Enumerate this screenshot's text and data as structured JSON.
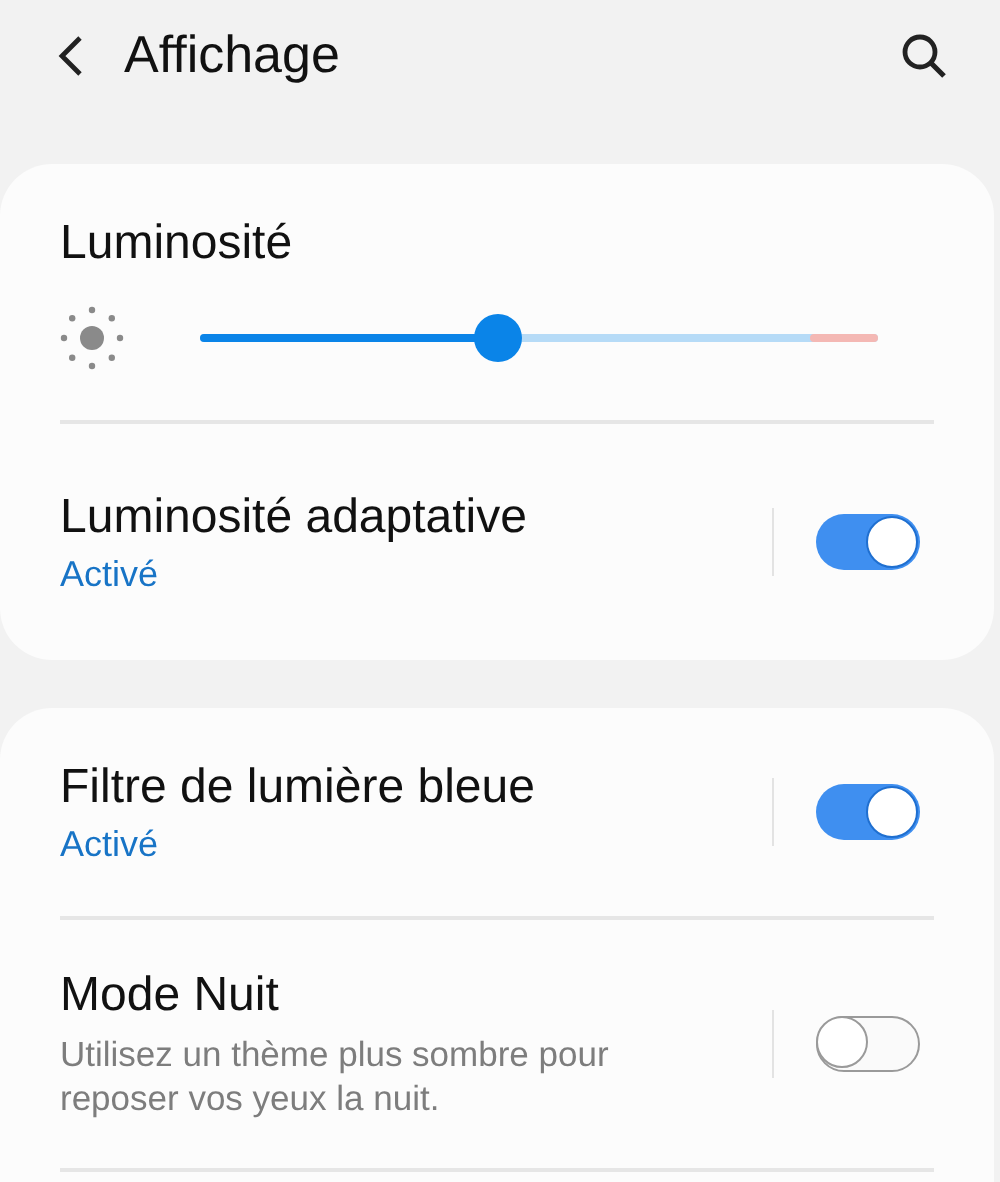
{
  "header": {
    "title": "Affichage"
  },
  "brightness": {
    "title": "Luminosité",
    "level": 0.44
  },
  "brightness_items": [
    {
      "title": "Luminosité adaptative",
      "status": "Activé",
      "on": true
    }
  ],
  "items": [
    {
      "title": "Filtre de lumière bleue",
      "status": "Activé",
      "on": true
    },
    {
      "title": "Mode Nuit",
      "description": "Utilisez un thème plus sombre pour reposer vos yeux la nuit.",
      "on": false
    }
  ]
}
